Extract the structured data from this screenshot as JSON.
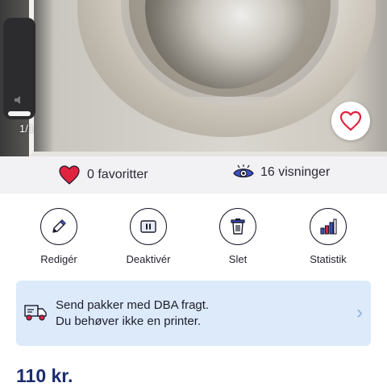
{
  "gallery": {
    "counter": "1/1"
  },
  "stats": {
    "favorites": "0 favoritter",
    "views": "16 visninger"
  },
  "actions": [
    {
      "label": "Redigér",
      "icon": "pencil-icon"
    },
    {
      "label": "Deaktivér",
      "icon": "pause-icon"
    },
    {
      "label": "Slet",
      "icon": "trash-icon"
    },
    {
      "label": "Statistik",
      "icon": "bar-chart-icon"
    }
  ],
  "shipping": {
    "line1": "Send pakker med DBA fragt.",
    "line2": "Du behøver ikke en printer.",
    "icon": "delivery-truck-icon",
    "chevron": "›"
  },
  "listing": {
    "price": "110 kr."
  },
  "colors": {
    "heart": "#e0233e",
    "accent": "#3b52c4",
    "banner": "#dceafa",
    "price": "#1a2c6e"
  }
}
